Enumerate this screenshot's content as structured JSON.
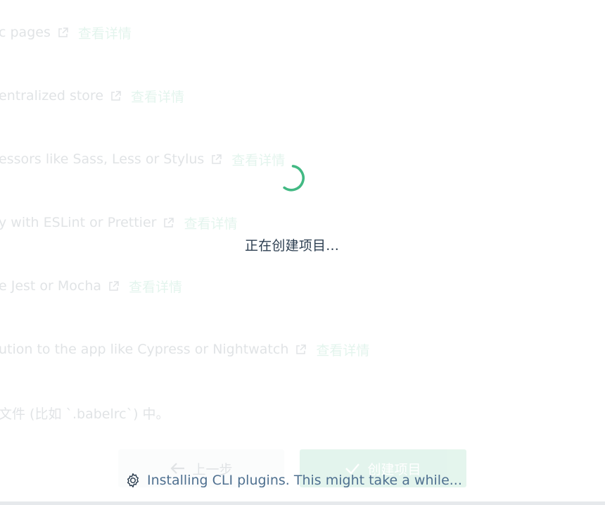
{
  "features": [
    {
      "text": "c pages",
      "link": "查看详情"
    },
    {
      "text": "entralized store",
      "link": "查看详情"
    },
    {
      "text": "essors like Sass, Less or Stylus",
      "link": "查看详情"
    },
    {
      "text": "y with ESLint or Prettier",
      "link": "查看详情"
    },
    {
      "text": "e Jest or Mocha",
      "link": "查看详情"
    },
    {
      "text": "ution to the app like Cypress or Nightwatch",
      "link": "查看详情"
    }
  ],
  "config_note": "文件 (比如 `.babelrc`) 中。",
  "buttons": {
    "prev_label": "上一步",
    "create_label": "创建项目"
  },
  "loading": {
    "message": "正在创建项目...",
    "status": "Installing CLI plugins. This might take a while..."
  },
  "colors": {
    "accent": "#42b983",
    "text": "#2c3e50",
    "status_text": "#4f7090"
  },
  "icons": {
    "external_link": "external-link-icon",
    "spinner": "loading-spinner-icon",
    "gear": "gear-icon",
    "arrow_left": "arrow-left-icon",
    "check": "check-icon"
  }
}
